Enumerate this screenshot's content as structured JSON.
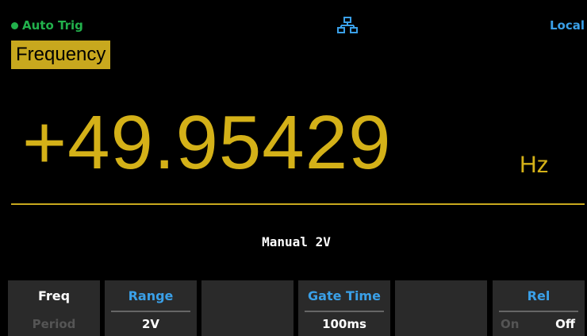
{
  "status": {
    "trigger_mode": "Auto Trig",
    "network_icon": "lan-network-icon",
    "remote_state": "Local"
  },
  "function_label": "Frequency",
  "measurement": {
    "value": "+49.95429",
    "unit": "Hz",
    "range_info": "Manual 2V"
  },
  "softkeys": [
    {
      "title": "Freq",
      "value": "Period"
    },
    {
      "title": "Range",
      "value": "2V"
    },
    {
      "title": "",
      "value": ""
    },
    {
      "title": "Gate Time",
      "value": "100ms"
    },
    {
      "title": "",
      "value": ""
    },
    {
      "title": "Rel",
      "on_label": "On",
      "off_label": "Off"
    }
  ],
  "colors": {
    "accent_yellow": "#c8a81e",
    "trigger_green": "#22b14c",
    "label_blue": "#3aa0e8"
  }
}
